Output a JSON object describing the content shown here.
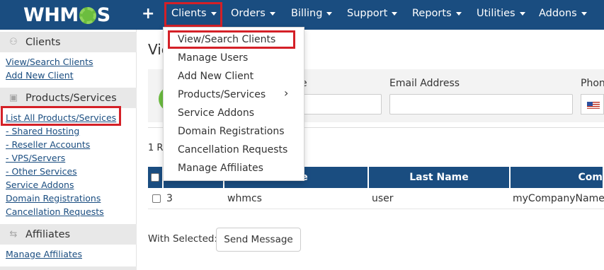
{
  "brand": {
    "logo_left": "WHM",
    "logo_right": "S",
    "accent": "#6cbd3f",
    "nav_bg": "#1a4d80",
    "highlight": "#d42027"
  },
  "nav": {
    "plus": "+",
    "items": [
      {
        "label": "Clients"
      },
      {
        "label": "Orders"
      },
      {
        "label": "Billing"
      },
      {
        "label": "Support"
      },
      {
        "label": "Reports"
      },
      {
        "label": "Utilities"
      },
      {
        "label": "Addons"
      }
    ]
  },
  "sidebar": {
    "sections": [
      {
        "title": "Clients",
        "icon": "users-icon"
      },
      {
        "title": "Products/Services",
        "icon": "cube-icon"
      },
      {
        "title": "Affiliates",
        "icon": "exchange-icon"
      }
    ],
    "clients_links": [
      "View/Search Clients",
      "Add New Client"
    ],
    "products_links": [
      "List All Products/Services",
      "- Shared Hosting",
      "- Reseller Accounts",
      "- VPS/Servers",
      "- Other Services",
      "Service Addons",
      "Domain Registrations",
      "Cancellation Requests"
    ],
    "affiliates_links": [
      "Manage Affiliates"
    ]
  },
  "main": {
    "title": "Vie",
    "fields": {
      "name_label_tail": "e",
      "email_label": "Email Address",
      "phone_label": "Phon"
    },
    "records": "1 R",
    "table": {
      "headers": [
        "",
        "",
        "ame",
        "Last Name",
        "Com"
      ],
      "row": {
        "id": "3",
        "first": "whmcs",
        "last": "user",
        "company": "myCompanyName"
      }
    },
    "with_selected": "With Selected:",
    "send_message": "Send Message"
  },
  "dropdown": {
    "items": [
      "View/Search Clients",
      "Manage Users",
      "Add New Client",
      "Products/Services",
      "Service Addons",
      "Domain Registrations",
      "Cancellation Requests",
      "Manage Affiliates"
    ],
    "chevron": "›"
  }
}
